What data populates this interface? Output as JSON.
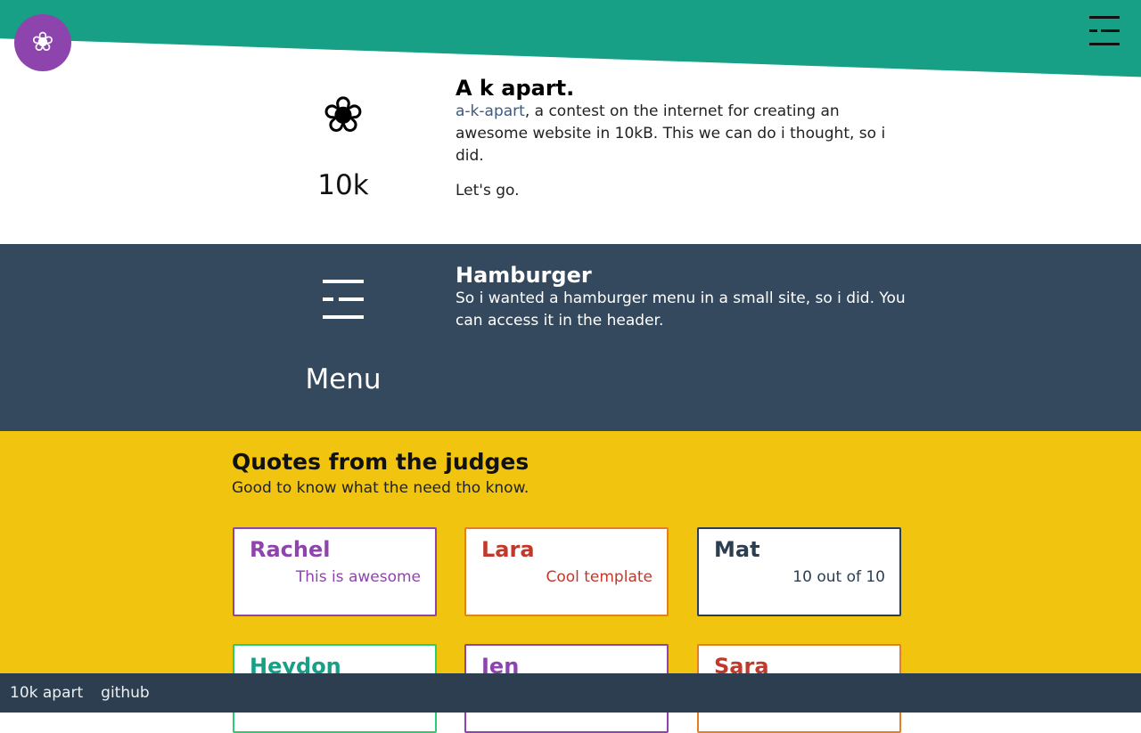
{
  "colors": {
    "header_green": "#17a086",
    "logo_purple": "#8e44ad",
    "dark_slate": "#34495e",
    "footer_slate": "#2c3e50",
    "yellow": "#f1c40f",
    "link_blue": "#3d5a80",
    "red": "#c0392b",
    "green": "#16a085",
    "orange": "#e67e22"
  },
  "header": {
    "logo_icon": "flower-icon",
    "logo_glyph": "❀",
    "menu_icon": "hamburger-icon"
  },
  "features": [
    {
      "icon": "flower-icon",
      "icon_glyph": "❀",
      "icon_label": "10k",
      "title": "A k apart.",
      "link_text": "a-k-apart",
      "body": ", a contest on the internet for creating an awesome website in 10kB. This we can do i thought, so i did.",
      "extra": "Let's go."
    },
    {
      "icon": "menu-icon",
      "icon_label": "Menu",
      "title": "Hamburger",
      "body": "So i wanted a hamburger menu in a small site, so i did. You can access it in the header."
    }
  ],
  "quotes": {
    "title": "Quotes from the judges",
    "subtitle": "Good to know what the need tho know.",
    "cards": [
      {
        "name": "Rachel",
        "quote": "This is awesome",
        "color": "#8e44ad"
      },
      {
        "name": "Lara",
        "quote": "Cool template",
        "color": "#c0392b",
        "border": "#e67e22"
      },
      {
        "name": "Mat",
        "quote": "10 out of 10",
        "color": "#2c3e50"
      },
      {
        "name": "Heydon",
        "quote": "",
        "color": "#16a085",
        "border": "#2ecc71"
      },
      {
        "name": "Jen",
        "quote": "",
        "color": "#8e44ad"
      },
      {
        "name": "Sara",
        "quote": "",
        "color": "#c0392b",
        "border": "#e67e22"
      }
    ]
  },
  "footer": {
    "links": [
      "10k apart",
      "github"
    ]
  }
}
